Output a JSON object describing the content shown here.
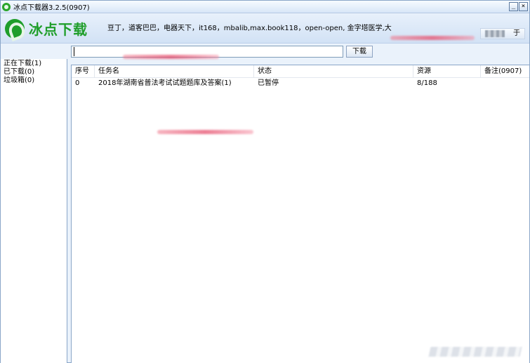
{
  "window": {
    "title": "冰点下载器3.2.5(0907)",
    "min_label": "_",
    "close_label": "×"
  },
  "header": {
    "logo_text": "冰点下载",
    "sites": "豆丁，道客巴巴，电器天下，it168，mbalib,max.book118，open-open, 金字塔医学,大",
    "user_label": "于"
  },
  "search": {
    "value": "",
    "button": "下载"
  },
  "sidebar": {
    "items": [
      {
        "label": "正在下载(1)"
      },
      {
        "label": "已下载(0)"
      },
      {
        "label": "垃圾箱(0)"
      }
    ]
  },
  "table": {
    "columns": [
      "序号",
      "任务名",
      "状态",
      "资源",
      "备注(0907)"
    ],
    "rows": [
      [
        "0",
        "2018年湖南省普法考试试题题库及答案(1)",
        "已暂停",
        "8/188",
        ""
      ]
    ]
  },
  "colors": {
    "accent_green": "#1f9e2a",
    "window_bg": "#eaf2fb",
    "border": "#8aa6c8"
  }
}
